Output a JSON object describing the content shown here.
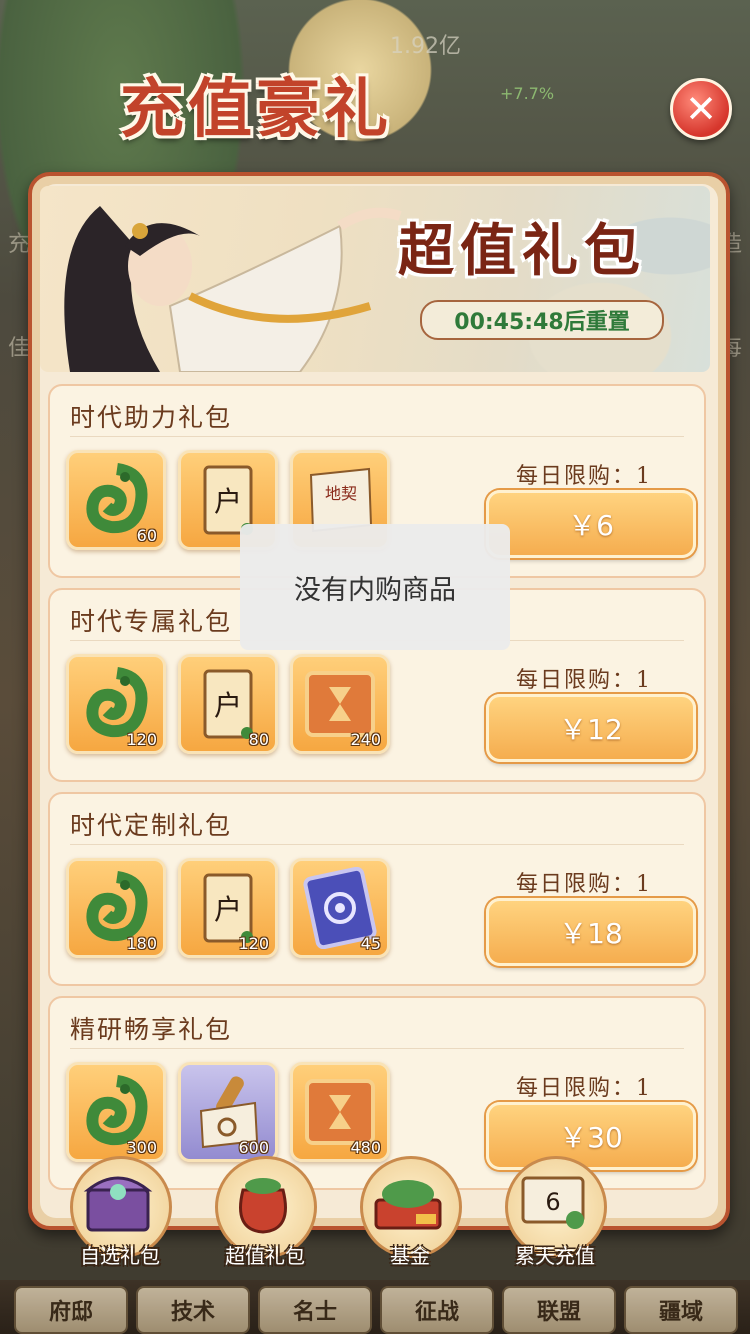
{
  "background": {
    "top_stat": "1.92亿",
    "top_pct": "+7.7%",
    "side_left": [
      "充",
      "佳"
    ],
    "side_right": [
      "造",
      "每"
    ]
  },
  "header": {
    "title": "充值豪礼",
    "close_icon": "close-icon"
  },
  "banner": {
    "title": "超值礼包",
    "reset_text": "00:45:48后重置"
  },
  "packages": [
    {
      "name": "时代助力礼包",
      "limit": "每日限购：1",
      "price": "￥6",
      "items": [
        {
          "icon": "jade-dragon-icon",
          "qty": "60"
        },
        {
          "icon": "household-book-icon",
          "qty": ""
        },
        {
          "icon": "land-deed-icon",
          "qty": ""
        }
      ]
    },
    {
      "name": "时代专属礼包",
      "limit": "每日限购：1",
      "price": "￥12",
      "items": [
        {
          "icon": "jade-dragon-icon",
          "qty": "120"
        },
        {
          "icon": "household-book-icon",
          "qty": "80"
        },
        {
          "icon": "hourglass-card-icon",
          "qty": "240"
        }
      ]
    },
    {
      "name": "时代定制礼包",
      "limit": "每日限购：1",
      "price": "￥18",
      "items": [
        {
          "icon": "jade-dragon-icon",
          "qty": "180"
        },
        {
          "icon": "household-book-icon",
          "qty": "120"
        },
        {
          "icon": "swirl-card-icon",
          "qty": "45"
        }
      ]
    },
    {
      "name": "精研畅享礼包",
      "limit": "每日限购：1",
      "price": "￥30",
      "items": [
        {
          "icon": "jade-dragon-icon",
          "qty": "300"
        },
        {
          "icon": "scroll-icon",
          "qty": "600"
        },
        {
          "icon": "hourglass-card-icon",
          "qty": "480"
        }
      ]
    }
  ],
  "toast": "没有内购商品",
  "tabs": [
    {
      "label": "自选礼包",
      "icon": "treasure-chest-icon"
    },
    {
      "label": "超值礼包",
      "icon": "money-bag-icon"
    },
    {
      "label": "基金",
      "icon": "jade-basin-icon"
    },
    {
      "label": "累天充值",
      "icon": "scroll-gift-icon"
    }
  ],
  "bottom_nav": [
    "府邸",
    "技术",
    "名士",
    "征战",
    "联盟",
    "疆域"
  ]
}
